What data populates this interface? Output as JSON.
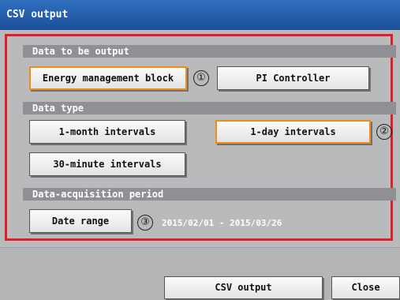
{
  "window": {
    "title": "CSV output"
  },
  "sections": {
    "data_output": {
      "header": "Data to be output",
      "buttons": [
        {
          "label": "Energy management block",
          "selected": true,
          "marker": "①"
        },
        {
          "label": "PI Controller",
          "selected": false
        }
      ]
    },
    "data_type": {
      "header": "Data type",
      "buttons": [
        {
          "label": "1-month intervals",
          "selected": false
        },
        {
          "label": "1-day intervals",
          "selected": true,
          "marker": "②"
        },
        {
          "label": "30-minute intervals",
          "selected": false
        }
      ]
    },
    "period": {
      "header": "Data-acquisition period",
      "button": {
        "label": "Date range",
        "marker": "③"
      },
      "range_text": "2015/02/01 - 2015/03/26"
    }
  },
  "footer": {
    "csv_output_label": "CSV output",
    "close_label": "Close"
  },
  "colors": {
    "title_bar": "#1d4f9a",
    "highlight_frame": "#e11d2a",
    "selected_border": "#f08c1a",
    "section_header": "#8e9093"
  }
}
